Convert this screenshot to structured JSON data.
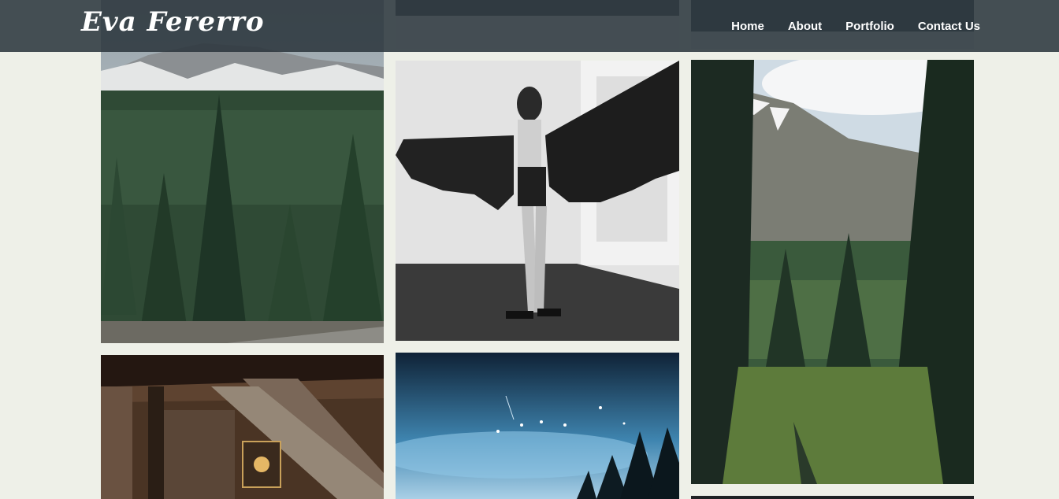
{
  "site": {
    "logo_text": "Eva Fererro"
  },
  "nav": {
    "items": [
      {
        "label": "Home"
      },
      {
        "label": "About"
      },
      {
        "label": "Portfolio"
      },
      {
        "label": "Contact Us"
      }
    ]
  },
  "colors": {
    "header_bg": "#2c373e",
    "page_bg": "#eef0e8",
    "nav_text": "#ffffff"
  }
}
